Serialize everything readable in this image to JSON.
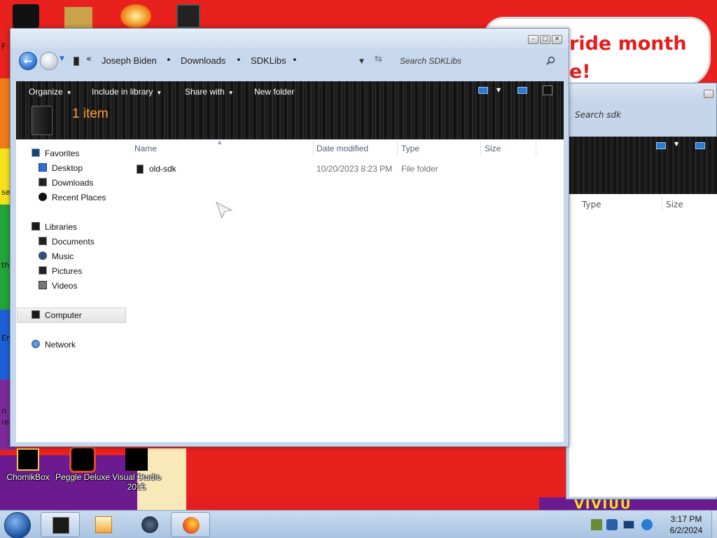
{
  "desktop": {
    "banner_line1": "ride month",
    "banner_line2": "e!",
    "edge_texts": [
      "F",
      "se",
      "th",
      "En",
      "n",
      "re"
    ],
    "bottom_deco": "VIVIUU",
    "icons": [
      {
        "label": "ChomikBox",
        "icon": "chomikbox-icon"
      },
      {
        "label": "Peggle Deluxe",
        "icon": "peggle-icon"
      },
      {
        "label": "Visual Studio 2015",
        "icon": "visual-studio-icon"
      }
    ]
  },
  "bg_window": {
    "search_placeholder": "Search sdk",
    "columns": [
      "Type",
      "Size"
    ]
  },
  "window": {
    "title_buttons": [
      "minimize",
      "maximize",
      "close"
    ],
    "breadcrumb_overflow": "«",
    "breadcrumb": [
      "Joseph Biden",
      "Downloads",
      "SDKLibs"
    ],
    "search_placeholder": "Search SDKLibs",
    "toolbar": {
      "organize": "Organize",
      "include_in_library": "Include in library",
      "share_with": "Share with",
      "new_folder": "New folder"
    },
    "item_count": "1 item",
    "nav": {
      "favorites": "Favorites",
      "favorites_items": [
        "Desktop",
        "Downloads",
        "Recent Places"
      ],
      "libraries": "Libraries",
      "libraries_items": [
        "Documents",
        "Music",
        "Pictures",
        "Videos"
      ],
      "computer": "Computer",
      "network": "Network"
    },
    "columns": {
      "name": "Name",
      "date_modified": "Date modified",
      "type": "Type",
      "size": "Size"
    },
    "files": [
      {
        "name": "old-sdk",
        "date_modified": "10/20/2023 8:23 PM",
        "type": "File folder",
        "size": ""
      }
    ]
  },
  "taskbar": {
    "apps": [
      "explorer",
      "media-player",
      "steam",
      "firefox"
    ],
    "active_apps": [
      "explorer",
      "firefox"
    ],
    "clock_time": "3:17 PM",
    "clock_date": "6/2/2024"
  },
  "colors": {
    "wallpaper_red": "#e8201e",
    "item_count_orange": "#ff9f32",
    "window_frame": "#c8d8ec",
    "toolbar_dark": "#1b1b1b"
  }
}
